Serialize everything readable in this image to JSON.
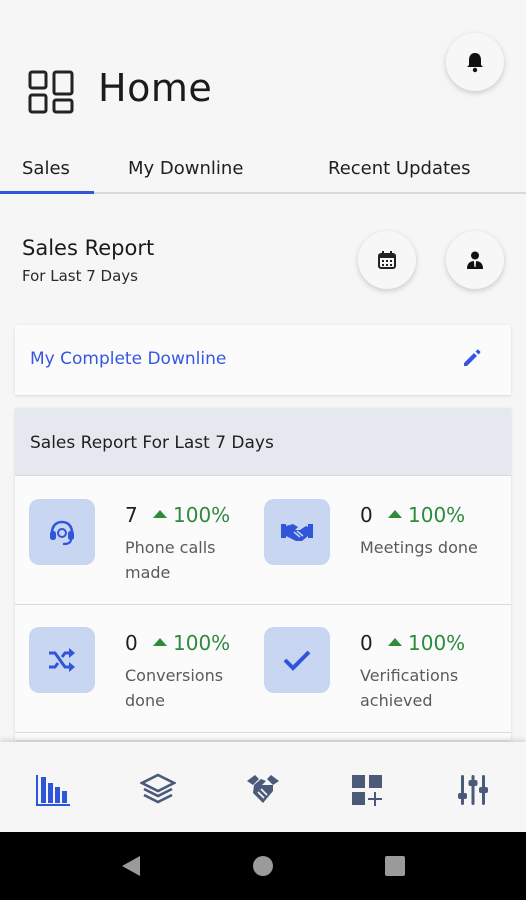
{
  "header": {
    "title": "Home",
    "icon": "dashboard-grid-icon",
    "notification_icon": "bell-icon"
  },
  "tabs": [
    {
      "label": "Sales",
      "active": true
    },
    {
      "label": "My Downline",
      "active": false
    },
    {
      "label": "Recent Updates",
      "active": false
    }
  ],
  "report": {
    "title": "Sales Report",
    "subtitle": "For Last 7 Days",
    "calendar_icon": "calendar-icon",
    "user_icon": "user-suit-icon"
  },
  "downline": {
    "label": "My Complete Downline",
    "icon": "pencil-icon"
  },
  "stats": {
    "heading": "Sales Report For Last 7 Days",
    "items": [
      {
        "icon": "headset-icon",
        "value": "7",
        "trend": "100%",
        "label": "Phone calls made"
      },
      {
        "icon": "handshake-icon",
        "value": "0",
        "trend": "100%",
        "label": "Meetings done"
      },
      {
        "icon": "shuffle-icon",
        "value": "0",
        "trend": "100%",
        "label": "Conversions done"
      },
      {
        "icon": "check-icon",
        "value": "0",
        "trend": "100%",
        "label": "Verifications achieved"
      }
    ]
  },
  "bottom_nav": [
    {
      "icon": "bar-chart-icon",
      "active": true
    },
    {
      "icon": "layers-icon",
      "active": false
    },
    {
      "icon": "handshake-icon",
      "active": false
    },
    {
      "icon": "add-widget-icon",
      "active": false
    },
    {
      "icon": "sliders-icon",
      "active": false
    }
  ],
  "colors": {
    "accent": "#2f56d8",
    "link": "#3557e0",
    "trend_up": "#2e8b3e",
    "icon_tile": "#c9d6f1",
    "nav_icon": "#4a5a78"
  }
}
